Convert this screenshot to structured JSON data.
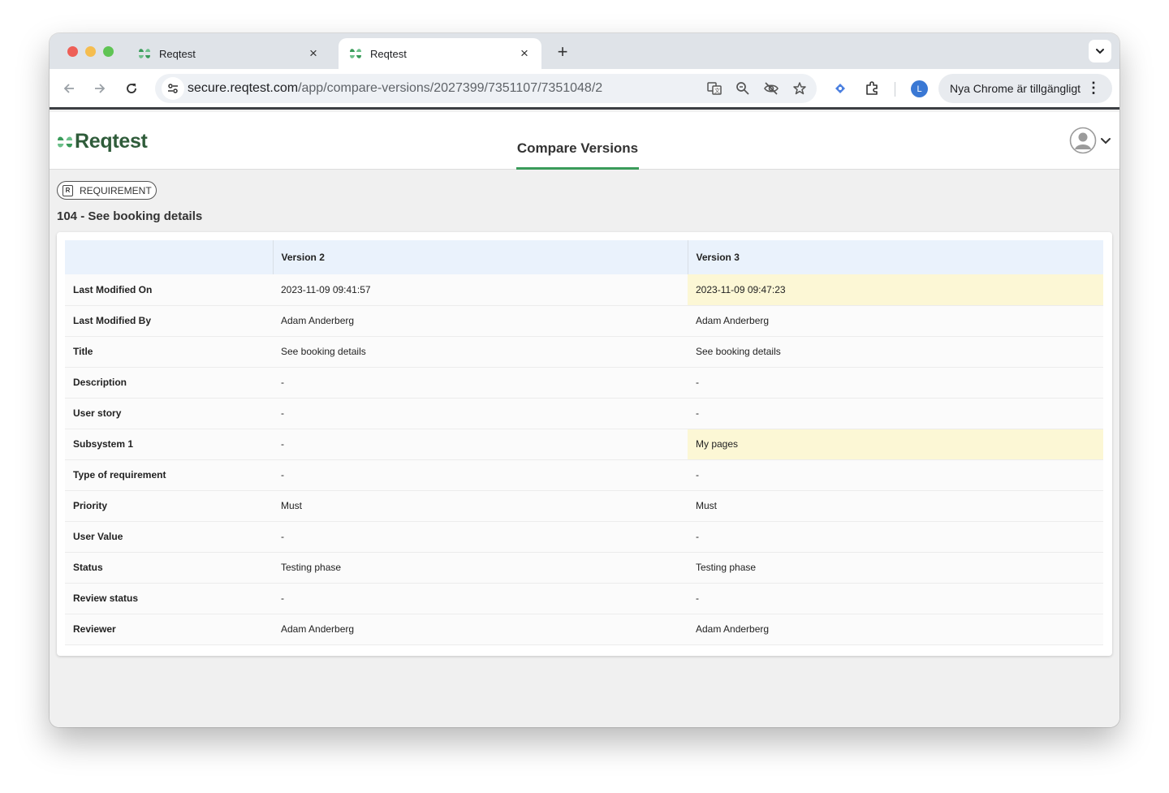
{
  "browser": {
    "tabs": [
      {
        "label": "Reqtest",
        "active": false,
        "close": "×"
      },
      {
        "label": "Reqtest",
        "active": true,
        "close": "×"
      }
    ],
    "new_tab": "+",
    "url_host": "secure.reqtest.com",
    "url_path": "/app/compare-versions/2027399/7351107/7351048/2",
    "profile_initial": "L",
    "update_label": "Nya Chrome är tillgängligt",
    "kebab": "⋮"
  },
  "app": {
    "logo_text": "Reqtest",
    "page_title": "Compare Versions",
    "brand_color": "#3a9b5a",
    "badge_icon_letter": "R",
    "badge_label": "REQUIREMENT",
    "requirement_title": "104 - See booking details"
  },
  "compare": {
    "headers": [
      "",
      "Version 2",
      "Version 3"
    ],
    "highlight_color": "#fcf7d5",
    "rows": [
      {
        "field": "Last Modified On",
        "v2": "2023-11-09 09:41:57",
        "v3": "2023-11-09 09:47:23",
        "changed": true
      },
      {
        "field": "Last Modified By",
        "v2": "Adam Anderberg",
        "v3": "Adam Anderberg",
        "changed": false
      },
      {
        "field": "Title",
        "v2": "See booking details",
        "v3": "See booking details",
        "changed": false
      },
      {
        "field": "Description",
        "v2": "-",
        "v3": "-",
        "changed": false
      },
      {
        "field": "User story",
        "v2": "-",
        "v3": "-",
        "changed": false
      },
      {
        "field": "Subsystem 1",
        "v2": "-",
        "v3": "My pages",
        "changed": true
      },
      {
        "field": "Type of requirement",
        "v2": "-",
        "v3": "-",
        "changed": false
      },
      {
        "field": "Priority",
        "v2": "Must",
        "v3": "Must",
        "changed": false
      },
      {
        "field": "User Value",
        "v2": "-",
        "v3": "-",
        "changed": false
      },
      {
        "field": "Status",
        "v2": "Testing phase",
        "v3": "Testing phase",
        "changed": false
      },
      {
        "field": "Review status",
        "v2": "-",
        "v3": "-",
        "changed": false
      },
      {
        "field": "Reviewer",
        "v2": "Adam Anderberg",
        "v3": "Adam Anderberg",
        "changed": false
      }
    ]
  }
}
